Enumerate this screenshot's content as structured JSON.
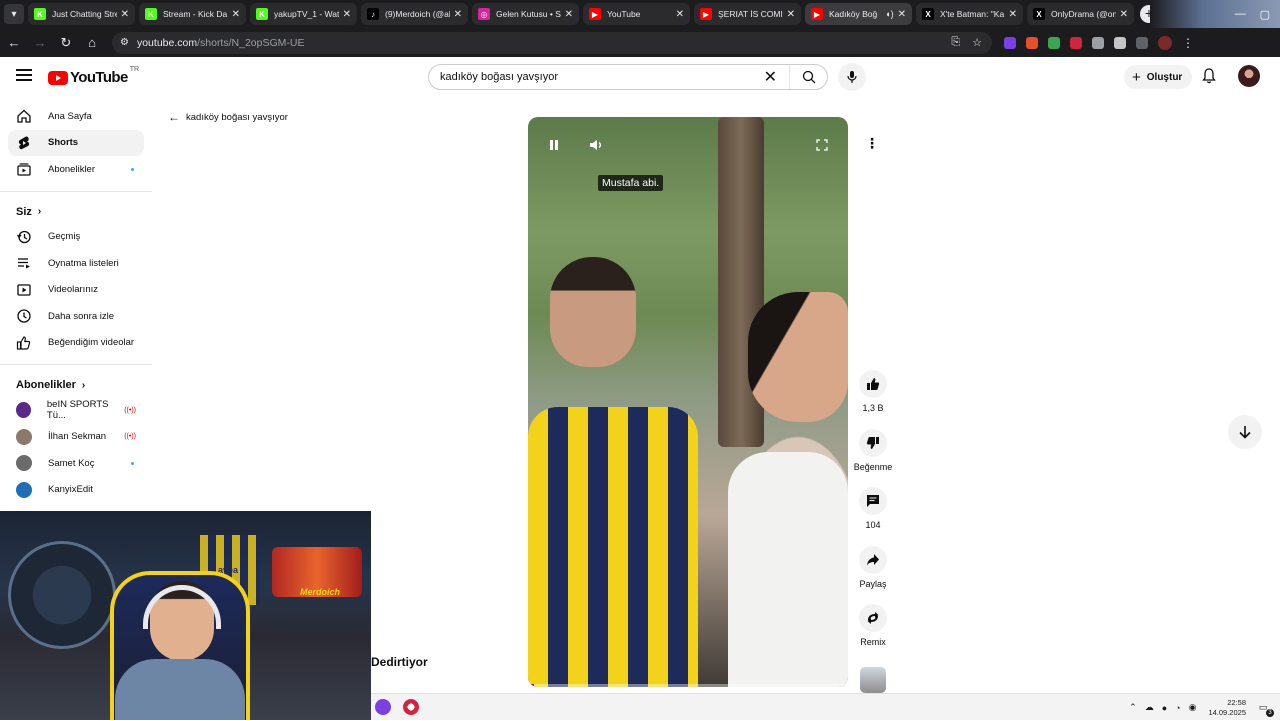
{
  "browser": {
    "tabs": [
      {
        "title": "Just Chatting Stre",
        "icon": "kick-icon",
        "color": "#53fc18",
        "active": false
      },
      {
        "title": "Stream - Kick Da",
        "icon": "kick-icon",
        "color": "#53fc18",
        "active": false
      },
      {
        "title": "yakupTV_1 - Wat",
        "icon": "kick-icon",
        "color": "#53fc18",
        "active": false
      },
      {
        "title": "(9)Merdoich (@al",
        "icon": "tiktok-icon",
        "color": "#000000",
        "active": false
      },
      {
        "title": "Gelen Kutusu • Sc",
        "icon": "instagram-icon",
        "color": "#d6249f",
        "active": false
      },
      {
        "title": "YouTube",
        "icon": "youtube-icon",
        "color": "#ff0000",
        "active": false
      },
      {
        "title": "ŞERIAT İS COMIN",
        "icon": "youtube-icon",
        "color": "#ff0000",
        "active": false
      },
      {
        "title": "Kadıköy Boğ",
        "icon": "youtube-icon",
        "color": "#ff0000",
        "active": true,
        "audio": true
      },
      {
        "title": "X'te Batman: \"Ka",
        "icon": "x-icon",
        "color": "#000000",
        "active": false
      },
      {
        "title": "OnlyDrama (@on",
        "icon": "x-icon",
        "color": "#000000",
        "active": false
      }
    ],
    "url_host": "youtube.com",
    "url_path": "/shorts/N_2opSGM-UE"
  },
  "header": {
    "logo_text": "YouTube",
    "country_code": "TR",
    "search_value": "kadıköy boğası yavşıyor",
    "create_label": "Oluştur"
  },
  "sidebar": {
    "main": [
      {
        "label": "Ana Sayfa",
        "icon": "home-icon"
      },
      {
        "label": "Shorts",
        "icon": "shorts-icon",
        "active": true
      },
      {
        "label": "Abonelikler",
        "icon": "subscriptions-icon",
        "dot": true
      }
    ],
    "you_title": "Siz",
    "you": [
      {
        "label": "Geçmiş",
        "icon": "history-icon"
      },
      {
        "label": "Oynatma listeleri",
        "icon": "playlists-icon"
      },
      {
        "label": "Videolarınız",
        "icon": "your-videos-icon"
      },
      {
        "label": "Daha sonra izle",
        "icon": "watch-later-icon"
      },
      {
        "label": "Beğendiğim videolar",
        "icon": "liked-videos-icon"
      }
    ],
    "subs_title": "Abonelikler",
    "subs": [
      {
        "label": "beIN SPORTS Tü...",
        "live": true,
        "color": "#5b2a86"
      },
      {
        "label": "İlhan Sekman",
        "live": true,
        "color": "#8a7a6a"
      },
      {
        "label": "Samet Koç",
        "dot": true,
        "color": "#6b6b6b"
      },
      {
        "label": "KanyixEdit",
        "color": "#1f6fb2"
      }
    ]
  },
  "main": {
    "back_query": "kadıköy boğası yavşıyor",
    "caption": "Mustafa abi.",
    "progress": 0.02,
    "actions": {
      "like_count": "1,3 B",
      "dislike_label": "Beğenme",
      "comment_count": "104",
      "share_label": "Paylaş",
      "remix_label": "Remix"
    }
  },
  "overlay": {
    "stream_title": "Dedirtiyor",
    "wc_brand": "Merdoich",
    "wc_avea": "avea"
  },
  "taskbar": {
    "time": "22:58",
    "date": "14.09.2025",
    "notifications": "3"
  }
}
